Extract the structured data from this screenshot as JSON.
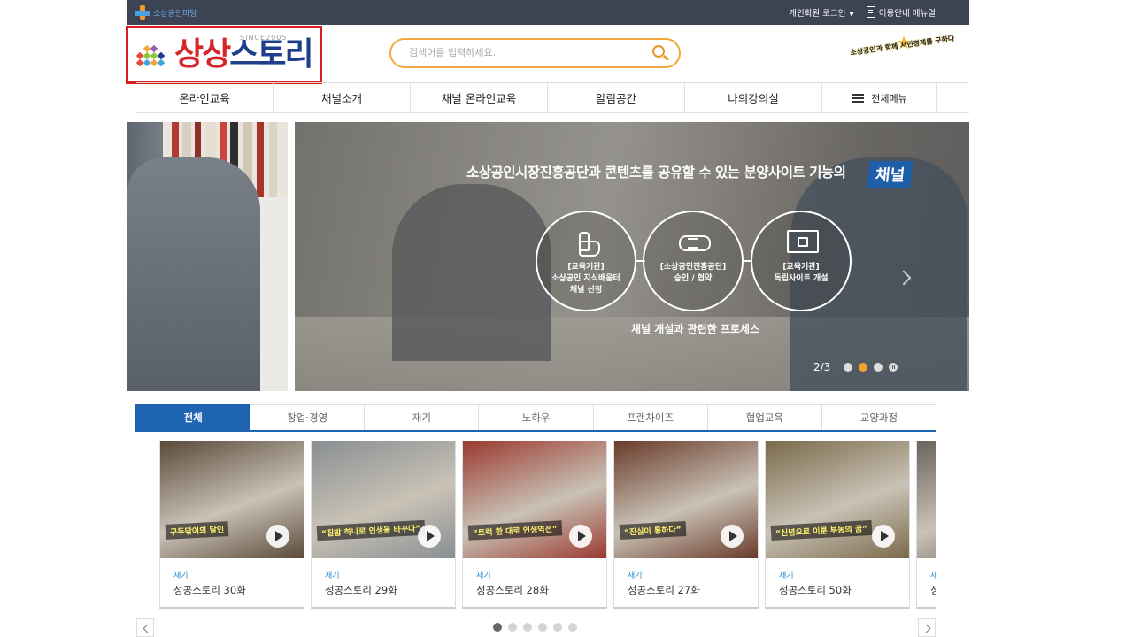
{
  "topbar": {
    "brand": "소상공인마당",
    "login": "개인회원 로그인",
    "guide": "이용안내 메뉴얼"
  },
  "header": {
    "logo_red": "상상",
    "logo_blue": "스토리",
    "logo_since": "SINCE2005",
    "search_placeholder": "검색어를 입력하세요.",
    "mascot_text": "소상공인과 함께 서민경제를 구하다"
  },
  "nav": {
    "items": [
      "온라인교육",
      "채널소개",
      "채널 온라인교육",
      "알림공간",
      "나의강의실"
    ],
    "all_menu": "전체메뉴"
  },
  "banner": {
    "headline": "소상공인시장진흥공단과 콘텐츠를 공유할 수 있는 분양사이트 기능의",
    "tag": "채널",
    "steps": [
      {
        "icon": "hand-click-icon",
        "line1": "[교육기관]",
        "line2": "소상공인 지식배움터",
        "line3": "채널 신청"
      },
      {
        "icon": "handshake-icon",
        "line1": "[소상공인진흥공단]",
        "line2": "승인 / 협약",
        "line3": ""
      },
      {
        "icon": "monitor-lock-icon",
        "line1": "[교육기관]",
        "line2": "독립사이트 개설",
        "line3": ""
      }
    ],
    "caption": "채널 개설과 관련한 프로세스",
    "counter": "2/3"
  },
  "tabs": [
    "전체",
    "창업·경영",
    "재기",
    "노하우",
    "프랜차이즈",
    "협업교육",
    "교양과정"
  ],
  "cards": [
    {
      "category": "재기",
      "title": "성공스토리 30화",
      "caption": "구두닦이의 달인",
      "color": "#5a4a3a"
    },
    {
      "category": "재기",
      "title": "성공스토리 29화",
      "caption": "“집밥 하나로 인생을 바꾸다”",
      "color": "#8a8f93"
    },
    {
      "category": "재기",
      "title": "성공스토리 28화",
      "caption": "“트럭 한 대로 인생역전”",
      "color": "#9b3a30"
    },
    {
      "category": "재기",
      "title": "성공스토리 27화",
      "caption": "“진심이 통하다”",
      "color": "#6a3b2a"
    },
    {
      "category": "재기",
      "title": "성공스토리 50화",
      "caption": "“신념으로 이룬 부농의 꿈”",
      "color": "#7a6a4a"
    },
    {
      "category": "재기",
      "title": "성",
      "caption": "",
      "color": "#6a6560"
    }
  ],
  "colors": {
    "topbar": "#3c4353",
    "accent_orange": "#f2a93b",
    "tab_active": "#1e64b0",
    "logo_red": "#d5262b",
    "logo_blue": "#1f3f8c"
  }
}
